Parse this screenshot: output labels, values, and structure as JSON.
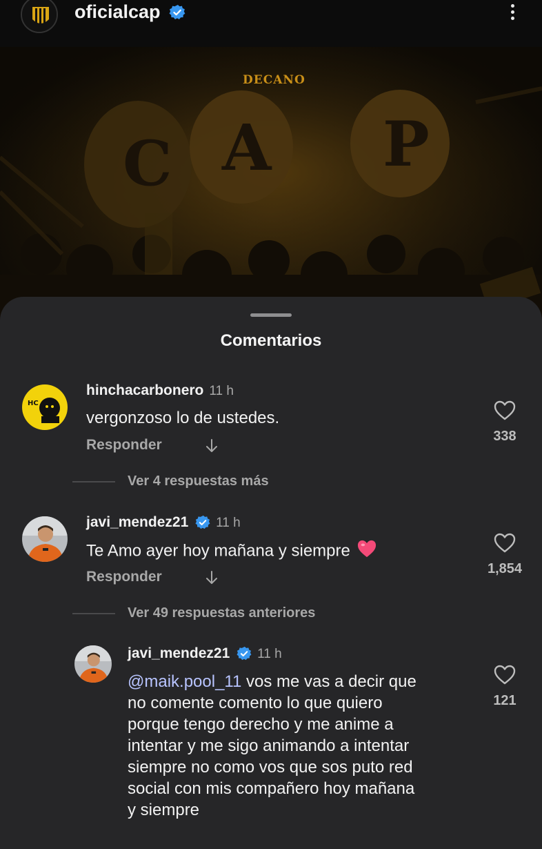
{
  "header": {
    "username": "oficialcap",
    "icons": {
      "verified": "verified-badge-icon",
      "more": "more-options-icon"
    }
  },
  "post": {
    "banner_text": "DECANO"
  },
  "comments_sheet": {
    "title": "Comentarios",
    "comments": [
      {
        "user": "hinchacarbonero",
        "time": "11 h",
        "text": "vergonzoso lo de ustedes.",
        "reply_label": "Responder",
        "likes": "338",
        "avatar_text": "HC",
        "view_more": "Ver 4 respuestas más"
      },
      {
        "user": "javi_mendez21",
        "verified": true,
        "time": "11 h",
        "text": "Te Amo ayer hoy mañana y siempre",
        "emoji": "❤️",
        "reply_label": "Responder",
        "likes": "1,854",
        "view_more": "Ver 49 respuestas anteriores"
      }
    ],
    "reply": {
      "user": "javi_mendez21",
      "verified": true,
      "time": "11 h",
      "mention": "@maik.pool_11",
      "text_line1": " vos me vas a decir que",
      "text_rest": [
        "no comente comento lo que quiero",
        "porque tengo derecho y me anime a",
        "intentar y me sigo animando a intentar",
        "siempre no como vos que sos puto red",
        "social con mis compañero hoy mañana",
        "y siempre"
      ],
      "likes": "121"
    },
    "colors": {
      "sheet_bg": "#262628",
      "mention": "#b8c4ff",
      "verified": "#3897f0"
    }
  }
}
